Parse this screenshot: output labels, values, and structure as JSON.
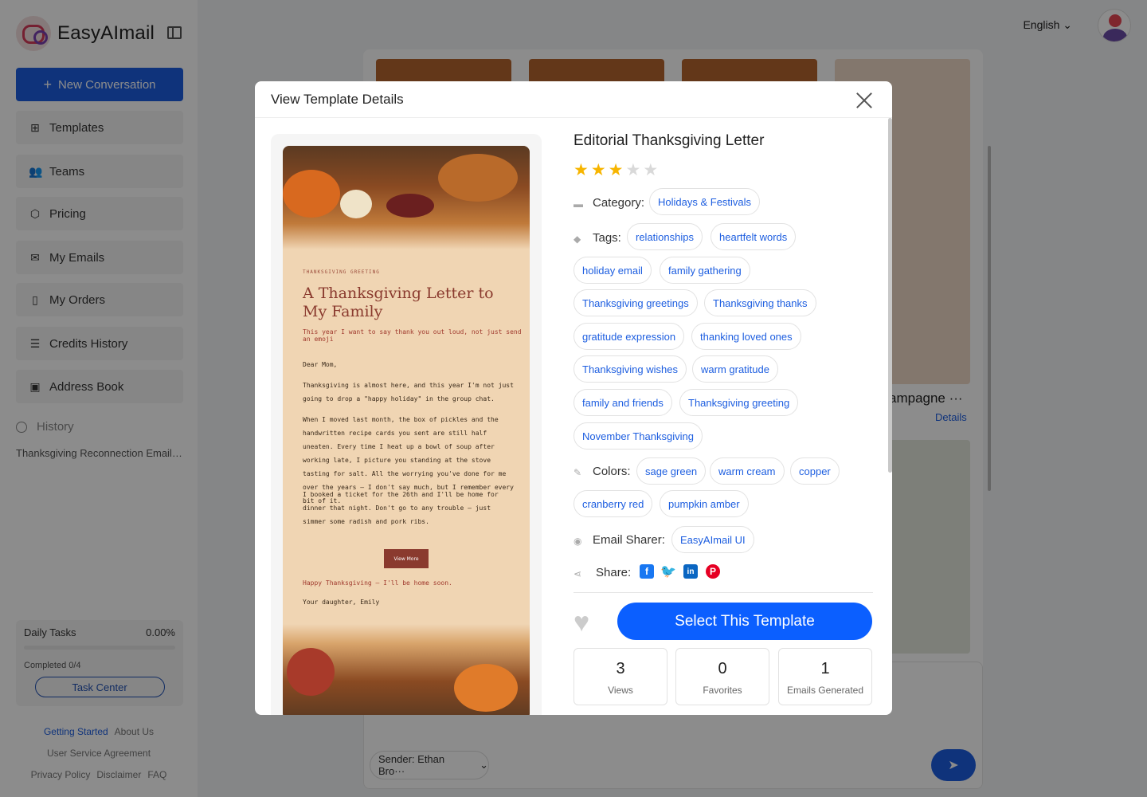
{
  "app": {
    "name": "EasyAImail"
  },
  "sidebar": {
    "new_conversation": "New Conversation",
    "items": [
      {
        "label": "Templates",
        "icon": "grid-icon"
      },
      {
        "label": "Teams",
        "icon": "users-icon"
      },
      {
        "label": "Pricing",
        "icon": "box-icon"
      },
      {
        "label": "My Emails",
        "icon": "mail-icon"
      },
      {
        "label": "My Orders",
        "icon": "clipboard-icon"
      },
      {
        "label": "Credits History",
        "icon": "database-icon"
      },
      {
        "label": "Address Book",
        "icon": "contact-book-icon"
      }
    ],
    "history_label": "History",
    "history_items": [
      "Thanksgiving Reconnection Email Template"
    ],
    "tasks": {
      "label": "Daily Tasks",
      "percent": "0.00%",
      "progress": 0,
      "completed": "Completed 0/4",
      "button": "Task Center"
    },
    "footer": {
      "getting_started": "Getting Started",
      "about": "About Us",
      "agreement": "User Service Agreement",
      "privacy": "Privacy Policy",
      "disclaimer": "Disclaimer",
      "faq": "FAQ"
    }
  },
  "topbar": {
    "language": "English"
  },
  "background": {
    "card_title": "ampagne ···",
    "details_link": "Details",
    "sender": "Sender: Ethan Bro···"
  },
  "modal": {
    "title": "View Template Details",
    "template": {
      "name": "Editorial Thanksgiving Letter",
      "rating": 3,
      "max_rating": 5,
      "category_label": "Category:",
      "category": "Holidays & Festivals",
      "tags_label": "Tags:",
      "tags": [
        "relationships",
        "heartfelt words",
        "holiday email",
        "family gathering",
        "Thanksgiving greetings",
        "Thanksgiving thanks",
        "gratitude expression",
        "thanking loved ones",
        "Thanksgiving wishes",
        "warm gratitude",
        "family and friends",
        "Thanksgiving greeting",
        "November Thanksgiving"
      ],
      "colors_label": "Colors:",
      "colors": [
        "sage green",
        "warm cream",
        "copper",
        "cranberry red",
        "pumpkin amber"
      ],
      "sharer_label": "Email Sharer:",
      "sharer": "EasyAImail UI",
      "share_label": "Share:",
      "share_networks": [
        "facebook-icon",
        "twitter-icon",
        "linkedin-icon",
        "pinterest-icon"
      ],
      "select_button": "Select This Template",
      "stats": [
        {
          "value": "3",
          "label": "Views"
        },
        {
          "value": "0",
          "label": "Favorites"
        },
        {
          "value": "1",
          "label": "Emails Generated"
        }
      ]
    },
    "preview": {
      "eyebrow": "THANKSGIVING GREETING",
      "headline": "A Thanksgiving Letter to My Family",
      "subhead": "This year I want to say thank you out loud, not just send an emoji",
      "salutation": "Dear Mom,",
      "p1": "Thanksgiving is almost here, and this year I'm not just going to drop a \"happy holiday\" in the group chat.",
      "p2": "When I moved last month, the box of pickles and the handwritten recipe cards you sent are still half uneaten. Every time I heat up a bowl of soup after working late, I picture you standing at the stove tasting for salt. All the worrying you've done for me over the years — I don't say much, but I remember every bit of it.",
      "p3": "I booked a ticket for the 26th and I'll be home for dinner that night. Don't go to any trouble — just simmer some radish and pork ribs.",
      "button": "View More",
      "closing": "Happy Thanksgiving — I'll be home soon.",
      "signature": "Your daughter, Emily"
    }
  },
  "colors": {
    "primary": "#1d5ee0",
    "select_button": "#0b5fff",
    "star_on": "#f7b500",
    "star_off": "#d9d9d9"
  }
}
